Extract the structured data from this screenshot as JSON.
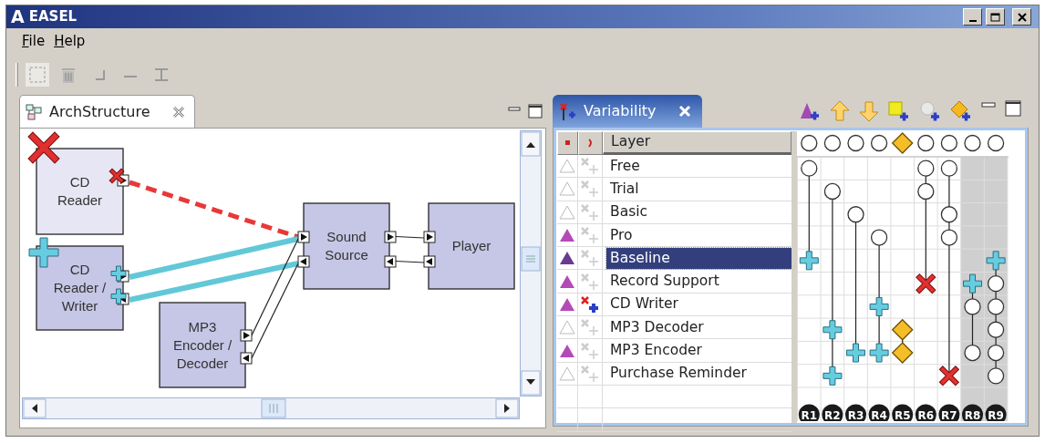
{
  "window": {
    "logo": "A",
    "title": "EASEL"
  },
  "menu": [
    {
      "label": "File"
    },
    {
      "label": "Help"
    }
  ],
  "arch_structure": {
    "tab": "ArchStructure",
    "components": [
      {
        "lines": [
          "CD",
          "Reader"
        ],
        "removed": true,
        "added": false
      },
      {
        "lines": [
          "CD",
          "Reader /",
          "Writer"
        ],
        "removed": false,
        "added": true
      },
      {
        "lines": [
          "MP3",
          "Encoder /",
          "Decoder"
        ],
        "removed": false,
        "added": false
      },
      {
        "lines": [
          "Sound",
          "Source"
        ],
        "removed": false,
        "added": false
      },
      {
        "lines": [
          "Player"
        ],
        "removed": false,
        "added": false
      }
    ],
    "links": [
      {
        "removed": true,
        "added": false
      },
      {
        "removed": false,
        "added": true
      },
      {
        "removed": false,
        "added": true
      },
      {
        "removed": false,
        "added": false
      },
      {
        "removed": false,
        "added": false
      },
      {
        "removed": false,
        "added": false
      },
      {
        "removed": false,
        "added": false
      }
    ]
  },
  "variability": {
    "tab": "Variability",
    "header": "Layer",
    "columns": [
      {
        "label": "R1",
        "head": {
          "kind": "circle"
        },
        "shaded": false
      },
      {
        "label": "R2",
        "head": {
          "kind": "circle"
        },
        "shaded": false
      },
      {
        "label": "R3",
        "head": {
          "kind": "circle"
        },
        "shaded": false
      },
      {
        "label": "R4",
        "head": {
          "kind": "circle"
        },
        "shaded": false
      },
      {
        "label": "R5",
        "head": {
          "kind": "diamond"
        },
        "shaded": false
      },
      {
        "label": "R6",
        "head": {
          "kind": "circle"
        },
        "shaded": false
      },
      {
        "label": "R7",
        "head": {
          "kind": "circle"
        },
        "shaded": false
      },
      {
        "label": "R8",
        "head": {
          "kind": "circle"
        },
        "shaded": true
      },
      {
        "label": "R9",
        "head": {
          "kind": "circle"
        },
        "shaded": true
      }
    ],
    "rows": [
      {
        "name": "Free",
        "included": false,
        "edited": false,
        "selected": false,
        "cells": [
          {
            "kind": "circle"
          },
          {
            "kind": "empty"
          },
          {
            "kind": "empty"
          },
          {
            "kind": "empty"
          },
          {
            "kind": "empty"
          },
          {
            "kind": "circle"
          },
          {
            "kind": "circle"
          },
          {
            "kind": "empty"
          },
          {
            "kind": "empty"
          }
        ]
      },
      {
        "name": "Trial",
        "included": false,
        "edited": false,
        "selected": false,
        "cells": [
          {
            "kind": "empty"
          },
          {
            "kind": "circle"
          },
          {
            "kind": "empty"
          },
          {
            "kind": "empty"
          },
          {
            "kind": "empty"
          },
          {
            "kind": "circle"
          },
          {
            "kind": "empty"
          },
          {
            "kind": "empty"
          },
          {
            "kind": "empty"
          }
        ]
      },
      {
        "name": "Basic",
        "included": false,
        "edited": false,
        "selected": false,
        "cells": [
          {
            "kind": "empty"
          },
          {
            "kind": "empty"
          },
          {
            "kind": "circle"
          },
          {
            "kind": "empty"
          },
          {
            "kind": "empty"
          },
          {
            "kind": "empty"
          },
          {
            "kind": "circle"
          },
          {
            "kind": "empty"
          },
          {
            "kind": "empty"
          }
        ]
      },
      {
        "name": "Pro",
        "included": true,
        "edited": false,
        "selected": false,
        "cells": [
          {
            "kind": "empty"
          },
          {
            "kind": "empty"
          },
          {
            "kind": "empty"
          },
          {
            "kind": "circle"
          },
          {
            "kind": "empty"
          },
          {
            "kind": "empty"
          },
          {
            "kind": "circle"
          },
          {
            "kind": "empty"
          },
          {
            "kind": "empty"
          }
        ]
      },
      {
        "name": "Baseline",
        "included": true,
        "edited": false,
        "selected": true,
        "cells": [
          {
            "kind": "plus"
          },
          {
            "kind": "empty"
          },
          {
            "kind": "empty"
          },
          {
            "kind": "empty"
          },
          {
            "kind": "empty"
          },
          {
            "kind": "empty"
          },
          {
            "kind": "empty"
          },
          {
            "kind": "empty"
          },
          {
            "kind": "plus"
          }
        ]
      },
      {
        "name": "Record Support",
        "included": true,
        "edited": false,
        "selected": false,
        "cells": [
          {
            "kind": "empty"
          },
          {
            "kind": "empty"
          },
          {
            "kind": "empty"
          },
          {
            "kind": "empty"
          },
          {
            "kind": "empty"
          },
          {
            "kind": "cross"
          },
          {
            "kind": "empty"
          },
          {
            "kind": "plus"
          },
          {
            "kind": "circle"
          }
        ]
      },
      {
        "name": "CD Writer",
        "included": true,
        "edited": true,
        "selected": false,
        "cells": [
          {
            "kind": "empty"
          },
          {
            "kind": "empty"
          },
          {
            "kind": "empty"
          },
          {
            "kind": "plus"
          },
          {
            "kind": "empty"
          },
          {
            "kind": "empty"
          },
          {
            "kind": "empty"
          },
          {
            "kind": "circle"
          },
          {
            "kind": "circle"
          }
        ]
      },
      {
        "name": "MP3 Decoder",
        "included": false,
        "edited": false,
        "selected": false,
        "cells": [
          {
            "kind": "empty"
          },
          {
            "kind": "plus"
          },
          {
            "kind": "empty"
          },
          {
            "kind": "empty"
          },
          {
            "kind": "diamond"
          },
          {
            "kind": "empty"
          },
          {
            "kind": "empty"
          },
          {
            "kind": "empty"
          },
          {
            "kind": "circle"
          }
        ]
      },
      {
        "name": "MP3 Encoder",
        "included": true,
        "edited": false,
        "selected": false,
        "cells": [
          {
            "kind": "empty"
          },
          {
            "kind": "empty"
          },
          {
            "kind": "plus"
          },
          {
            "kind": "plus"
          },
          {
            "kind": "diamond"
          },
          {
            "kind": "empty"
          },
          {
            "kind": "empty"
          },
          {
            "kind": "circle"
          },
          {
            "kind": "circle"
          }
        ]
      },
      {
        "name": "Purchase Reminder",
        "included": false,
        "edited": false,
        "selected": false,
        "cells": [
          {
            "kind": "empty"
          },
          {
            "kind": "plus"
          },
          {
            "kind": "empty"
          },
          {
            "kind": "empty"
          },
          {
            "kind": "empty"
          },
          {
            "kind": "empty"
          },
          {
            "kind": "cross"
          },
          {
            "kind": "empty"
          },
          {
            "kind": "circle"
          }
        ]
      }
    ]
  }
}
